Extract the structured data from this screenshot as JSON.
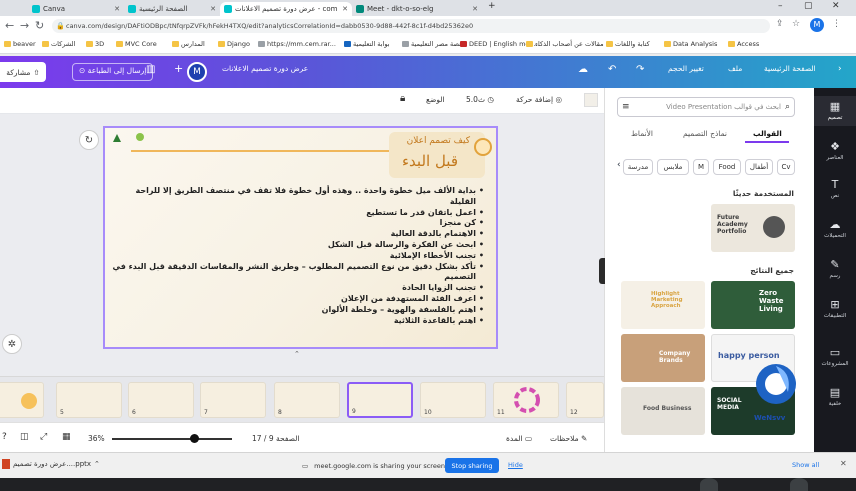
{
  "browser": {
    "tabs": [
      {
        "title": "Canva",
        "color": "#00c4cc",
        "active": false
      },
      {
        "title": "الصفحة الرئيسية",
        "color": "#00c4cc",
        "active": false
      },
      {
        "title": "عرض دورة تصميم الاعلانات - com",
        "color": "#00c4cc",
        "active": true
      },
      {
        "title": "Meet - dkt-o-so-elg",
        "color": "#00897b",
        "active": false
      }
    ],
    "url": "canva.com/design/DAFtiODBpc/tNfqrpZVFk/hFekH4TXQ/edit?analyticsCorrelationId=dabb0530-9d88-442f-8c1f-d4bd25362e0",
    "bookmarks": [
      "beaver",
      "الشركات",
      "3D",
      "MVC Core",
      "المدارس",
      "Django",
      "https://mm.cem.rar...",
      "بوابة التعليمية",
      "منصة مصر التعليمية",
      "DEED | English mea...",
      "مقالات عن أصحاب الذكاء",
      "كتابة واللغات",
      "Data Analysis",
      "Access"
    ]
  },
  "canva_header": {
    "home": "الصفحة الرئيسية",
    "file": "ملف",
    "resize": "تغيير الحجم",
    "design_title": "عرض دورة تصميم الاعلانات",
    "avatar": "M",
    "plus": "+",
    "send": "إرسال إلى الطباعة",
    "share": "مشاركة"
  },
  "toolbar": {
    "add_animation": "إضافة حركة",
    "duration": "5.0ث",
    "position": "الوضع"
  },
  "slide": {
    "title_small": "كيف تصمم اعلان",
    "title_big": "قبل البدء",
    "bullets": [
      "بداية الألف ميل خطوة واحدة .. وهذه أول خطوة فلا تقف في منتصف الطريق إلا للراحة القليلة",
      "اعمل باتقان قدر ما تستطيع",
      "كن منجزا",
      "الاهتمام بالدقة العالية",
      "ابحث عن الفكرة والرسالة قبل الشكل",
      "تجنب الأخطاء الإملائية",
      "تأكد بشكل دقيق من نوع التصميم المطلوب – وطريق النشر والمقاسات الدقيقة قبل البدء في التصميم",
      "تجنب الزوايا الحادة",
      "اعرف الفئة المستهدفة من الإعلان",
      "اهتم بالفلسفة والهوية – وخلطة الألوان",
      "اهتم بالقاعدة الثلاثية"
    ]
  },
  "thumbnails": [
    {
      "num": "5"
    },
    {
      "num": "6"
    },
    {
      "num": "7"
    },
    {
      "num": "8"
    },
    {
      "num": "9"
    },
    {
      "num": "10"
    },
    {
      "num": "11"
    },
    {
      "num": "12"
    }
  ],
  "active_thumb": "9",
  "bottombar": {
    "notes": "ملاحظات",
    "duration": "المدة",
    "page": "الصفحة 9 / 17",
    "zoom": "36%",
    "zoom_fraction": 0.68
  },
  "side_panel": {
    "search_placeholder": "ابحث في قوالب Video Presentation",
    "tabs": [
      "القوالب",
      "نماذج التصميم",
      "الأنماط"
    ],
    "chips": [
      "Cv",
      "أطفال",
      "Food",
      "M",
      "ملابس",
      "مدرسة"
    ],
    "recent_title": "المستخدمة حديثًا",
    "recent_text": "Future Academy Portfolio",
    "results_title": "جميع النتائج",
    "templates": [
      {
        "text": "Highlight Marketing Approach",
        "bg": "#f5f0e6",
        "fg": "#d9a441"
      },
      {
        "text": "Zero Waste Living",
        "bg": "#2f5d3a",
        "fg": "#ffffff"
      },
      {
        "text": "Company Brands",
        "bg": "#c8a07a",
        "fg": "#ffffff"
      },
      {
        "text": "happy person",
        "bg": "#f4f4f4",
        "fg": "#3a5ba0"
      },
      {
        "text": "Food Business",
        "bg": "#e6e2da",
        "fg": "#555555"
      },
      {
        "text": "SOCIAL MEDIA",
        "bg": "#1d3b2a",
        "fg": "#ffffff"
      }
    ]
  },
  "rail": [
    {
      "label": "تصميم",
      "icon": "▦"
    },
    {
      "label": "العناصر",
      "icon": "❖"
    },
    {
      "label": "نص",
      "icon": "T"
    },
    {
      "label": "التحميلات",
      "icon": "☁"
    },
    {
      "label": "رسم",
      "icon": "✎"
    },
    {
      "label": "التطبيقات",
      "icon": "⊞"
    },
    {
      "label": "المشروعات",
      "icon": "▭"
    },
    {
      "label": "خلفية",
      "icon": "▤"
    }
  ],
  "meet": {
    "download": "عرض دورة تصميم....pptx",
    "message": "meet.google.com is sharing your screen.",
    "stop": "Stop sharing",
    "hide": "Hide",
    "show_all": "Show all"
  },
  "watermark": "WeNsvv"
}
